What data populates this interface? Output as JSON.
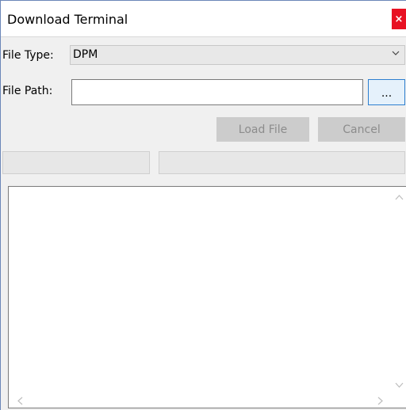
{
  "window": {
    "title": "Download Terminal",
    "close_glyph": "×"
  },
  "file_type": {
    "label": "File Type:",
    "selected": "DPM",
    "chevron_icon": "chevron-down-icon"
  },
  "file_path": {
    "label": "File Path:",
    "value": "",
    "placeholder": "",
    "browse_label": "..."
  },
  "actions": {
    "load_label": "Load File",
    "cancel_label": "Cancel"
  },
  "output": {
    "text": ""
  },
  "colors": {
    "close_bg": "#e81123",
    "disabled_button_bg": "#cccccc",
    "disabled_button_text": "#8c8c8c",
    "focus_border": "#2d7fd0"
  }
}
